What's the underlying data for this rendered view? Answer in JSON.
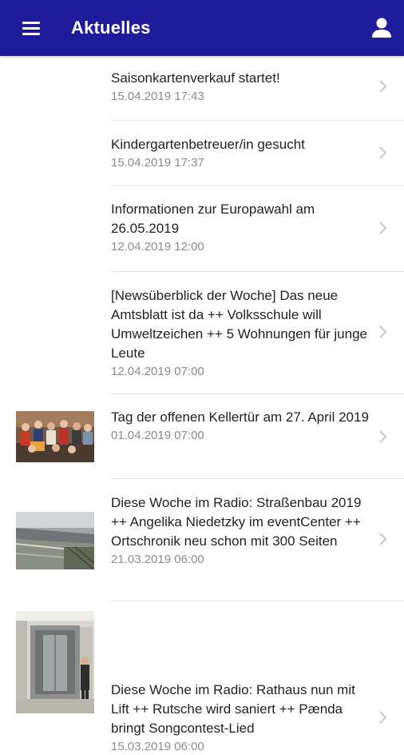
{
  "appbar": {
    "title": "Aktuelles",
    "menu_icon": "hamburger-menu-icon",
    "profile_icon": "person-icon",
    "color": "#1f1c9c"
  },
  "news": [
    {
      "headline": "Saisonkartenverkauf startet!",
      "date": "15.04.2019 17:43",
      "thumbnail": null
    },
    {
      "headline": "Kindergartenbetreuer/in gesucht",
      "date": "15.04.2019 17:37",
      "thumbnail": null
    },
    {
      "headline": "Informationen zur Europawahl am 26.05.2019",
      "date": "12.04.2019 12:00",
      "thumbnail": null
    },
    {
      "headline": "[Newsüberblick der Woche] Das neue Amtsblatt ist da ++ Volksschule will Umweltzeichen ++ 5 Wohnungen für junge Leute",
      "date": "12.04.2019 07:00",
      "thumbnail": null
    },
    {
      "headline": "Tag der offenen Kellertür am 27. April 2019",
      "date": "01.04.2019 07:00",
      "thumbnail": "group-photo"
    },
    {
      "headline": "Diese Woche im Radio: Straßenbau 2019 ++ Angelika Niedetzky im eventCenter ++ Ortschronik neu schon mit 300 Seiten",
      "date": "21.03.2019 06:00",
      "thumbnail": "road-photo"
    },
    {
      "headline": "Diese Woche im Radio: Rathaus nun mit Lift ++ Rutsche wird saniert ++ Pænda bringt Songcontest-Lied",
      "date": "15.03.2019 06:00",
      "thumbnail": "elevator-photo"
    }
  ]
}
